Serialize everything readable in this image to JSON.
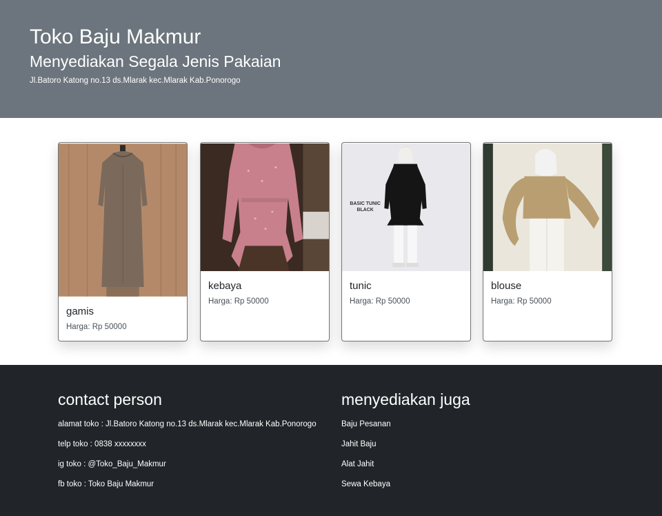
{
  "hero": {
    "title": "Toko Baju Makmur",
    "subtitle": "Menyediakan Segala Jenis Pakaian",
    "address": "Jl.Batoro Katong no.13 ds.Mlarak kec.Mlarak Kab.Ponorogo"
  },
  "products": [
    {
      "name": "gamis",
      "price": "Harga: Rp 50000",
      "photo_label": "gamis"
    },
    {
      "name": "kebaya",
      "price": "Harga: Rp 50000",
      "photo_label": "kebaya"
    },
    {
      "name": "tunic",
      "price": "Harga: Rp 50000",
      "photo_label": "BASIC TUNIC BLACK"
    },
    {
      "name": "blouse",
      "price": "Harga: Rp 50000",
      "photo_label": "blouse"
    }
  ],
  "footer": {
    "contact": {
      "heading": "contact person",
      "lines": [
        "alamat toko : Jl.Batoro Katong no.13 ds.Mlarak kec.Mlarak Kab.Ponorogo",
        "telp toko : 0838 xxxxxxxx",
        "ig toko : @Toko_Baju_Makmur",
        "fb toko : Toko Baju Makmur"
      ]
    },
    "services": {
      "heading": "menyediakan juga",
      "lines": [
        "Baju Pesanan",
        "Jahit Baju",
        "Alat Jahit",
        "Sewa Kebaya"
      ]
    }
  },
  "colors": {
    "hero_bg": "#6c757d",
    "footer_bg": "#212529"
  }
}
